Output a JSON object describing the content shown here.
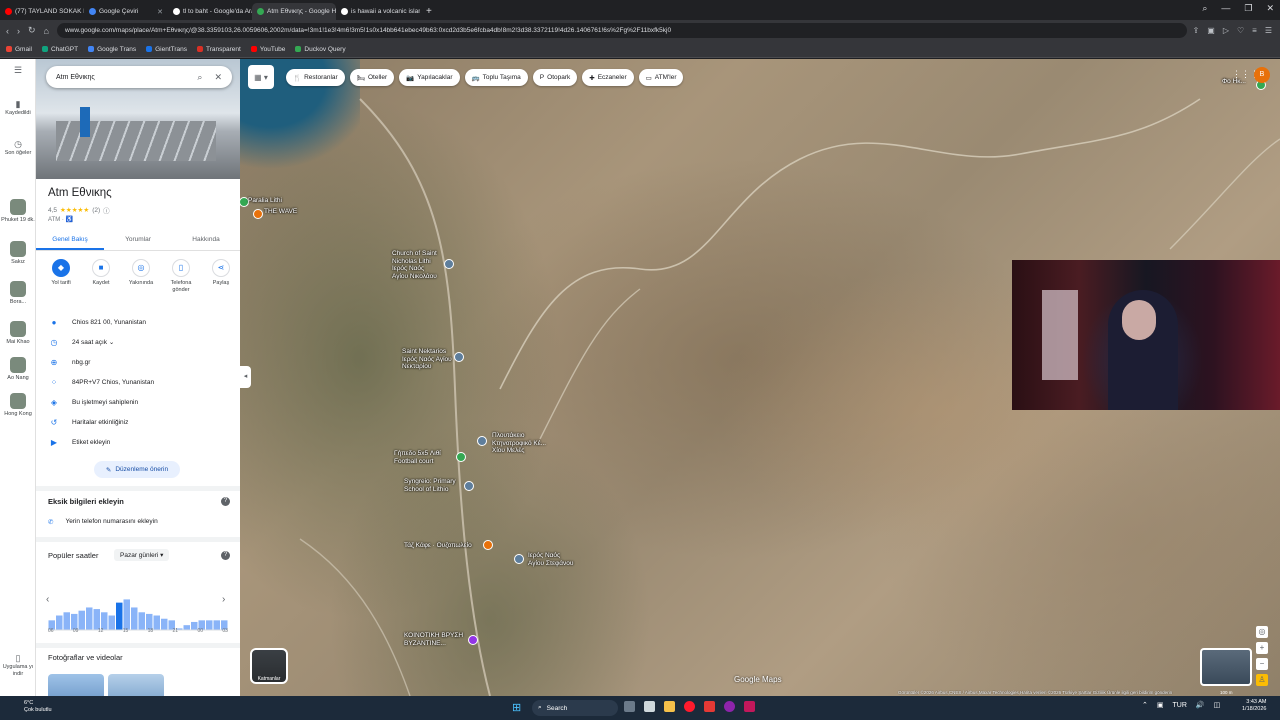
{
  "browser": {
    "tabs": [
      {
        "title": "(77) TAYLAND SOKAK LEZ",
        "color": "#ff0000",
        "active": false
      },
      {
        "title": "Google Çeviri",
        "color": "#4285f4",
        "active": false
      },
      {
        "title": "tl to baht - Google'da Ara",
        "color": "#ffffff",
        "active": false
      },
      {
        "title": "Atm Εθνικης - Google Ha",
        "color": "#34a853",
        "active": true
      },
      {
        "title": "is hawaii a volcanic island",
        "color": "#ffffff",
        "active": false
      }
    ],
    "new_tab": "+",
    "url": "www.google.com/maps/place/Atm+Εθνικης/@38.3359103,26.0059606,2002m/data=!3m1!1e3!4m6!3m5!1s0x14bb641ebec49b63:0xcd2d3b5e6fcba4db!8m2!3d38.3372119!4d26.1406761!6s%2Fg%2F11bxfk5kj0",
    "bookmarks": [
      {
        "label": "Gmail",
        "color": "#ea4335"
      },
      {
        "label": "ChatGPT",
        "color": "#10a37f"
      },
      {
        "label": "Google Trans",
        "color": "#4285f4"
      },
      {
        "label": "GientTrans",
        "color": "#1a73e8"
      },
      {
        "label": "Transparent",
        "color": "#d93025"
      },
      {
        "label": "YouTube",
        "color": "#ff0000"
      },
      {
        "label": "Duckov Query",
        "color": "#34a853"
      }
    ]
  },
  "rail": {
    "saved": "Kaydedildi",
    "recent": "Son öğeler",
    "items": [
      {
        "label": "Phuket 19 dk."
      },
      {
        "label": "Sakız"
      },
      {
        "label": "Bora..."
      },
      {
        "label": "Mai Khao"
      },
      {
        "label": "Ao Nang"
      },
      {
        "label": "Hong Kong"
      }
    ],
    "apps": "Uygulama yı indir"
  },
  "panel": {
    "search_value": "Atm Εθνικης",
    "title": "Atm Εθνικης",
    "rating": "4,5",
    "stars": "★★★★★",
    "reviews": "(2)",
    "type": "ATM · ♿",
    "tabs": [
      "Genel Bakış",
      "Yorumlar",
      "Hakkında"
    ],
    "actions": [
      {
        "label": "Yol tarifi",
        "icon": "◆"
      },
      {
        "label": "Kaydet",
        "icon": "■"
      },
      {
        "label": "Yakınında",
        "icon": "◎"
      },
      {
        "label": "Telefona gönder",
        "icon": "▯"
      },
      {
        "label": "Paylaş",
        "icon": "⋖"
      }
    ],
    "info": [
      {
        "icon": "●",
        "text": "Chios 821 00, Yunanistan"
      },
      {
        "icon": "◷",
        "text": "24 saat açık  ⌄"
      },
      {
        "icon": "⊕",
        "text": "nbg.gr"
      },
      {
        "icon": "⁘",
        "text": "84PR+V7 Chios, Yunanistan"
      },
      {
        "icon": "◈",
        "text": "Bu işletmeyi sahiplenin"
      },
      {
        "icon": "↺",
        "text": "Haritalar etkinliğiniz"
      },
      {
        "icon": "▶",
        "text": "Etiket ekleyin"
      }
    ],
    "suggest_edit": "Düzenleme önerin",
    "missing_title": "Eksik bilgileri ekleyin",
    "add_phone": "Yerin telefon numarasını ekleyin",
    "popular_title": "Popüler saatler",
    "day": "Pazar günleri",
    "photos_title": "Fotoğraflar ve videolar"
  },
  "chart_data": {
    "type": "bar",
    "title": "",
    "categories": [
      "06",
      "09",
      "12",
      "15",
      "18",
      "21",
      "00",
      "03"
    ],
    "values": [
      0.3,
      0.45,
      0.55,
      0.5,
      0.6,
      0.7,
      0.65,
      0.55,
      0.45,
      0.85,
      0.95,
      0.7,
      0.55,
      0.5,
      0.45,
      0.35,
      0.3,
      0.05,
      0.15,
      0.25,
      0.3,
      0.3,
      0.3,
      0.3
    ],
    "ylim": [
      0,
      1
    ],
    "color": "#8ab4f8",
    "highlight_color": "#1a73e8"
  },
  "map": {
    "layers_icon": "▦ ▾",
    "chips": [
      {
        "icon": "🍴",
        "label": "Restoranlar"
      },
      {
        "icon": "🛏",
        "label": "Oteller"
      },
      {
        "icon": "📷",
        "label": "Yapılacaklar"
      },
      {
        "icon": "🚌",
        "label": "Toplu Taşıma"
      },
      {
        "icon": "P",
        "label": "Otopark"
      },
      {
        "icon": "✚",
        "label": "Eczaneler"
      },
      {
        "icon": "▭",
        "label": "ATM'ler"
      }
    ],
    "labels": [
      {
        "text": "Paralia Lithi"
      },
      {
        "text": "THE WAVE"
      },
      {
        "text": "Church of Saint\nNicholas Lithi\nΙερός Ναός\nΑγίου Νικολάου"
      },
      {
        "text": "Saint Nektarios\nΙερός Ναός Αγίου\nΝεκταρίου"
      },
      {
        "text": "Πλουτάκειο\nΚτηνοτροφικό Κέ...\nΧίου Μελές"
      },
      {
        "text": "Γήπεδο 5x5 Λιθί\nFootball court"
      },
      {
        "text": "Syngreio: Primary\nSchool of Lithio"
      },
      {
        "text": "Τάζ Κάφε · Ουζοπωλείο"
      },
      {
        "text": "Ιερός Ναός\nΑγίου Στεφάνου"
      },
      {
        "text": "ΚΟΙΝΟΤΙΚΗ ΒΡΥΣΗ\nΒΥΖΑΝΤΙΝΕ..."
      },
      {
        "text": "Φο Ηκ..."
      }
    ],
    "apps_icon": "⋮⋮⋮",
    "avatar": "B",
    "layer_thumb": "Katmanlar",
    "google_logo": "Google Maps",
    "attribution": "Görüntüler ©2026 Airbus,CNES / Airbus,Maxar Technologies,Harita verileri ©2026  Türkiye  Şartlar  Gizlilik  Ürünle ilgili geri bildirim gönderin",
    "scale": "100 m",
    "zoom_in": "+",
    "zoom_out": "−"
  },
  "taskbar": {
    "weather_temp": "6°C",
    "weather_desc": "Çok bulutlu",
    "search": "Search",
    "lang": "TUR",
    "time": "3:43 AM",
    "date": "1/18/2026"
  }
}
